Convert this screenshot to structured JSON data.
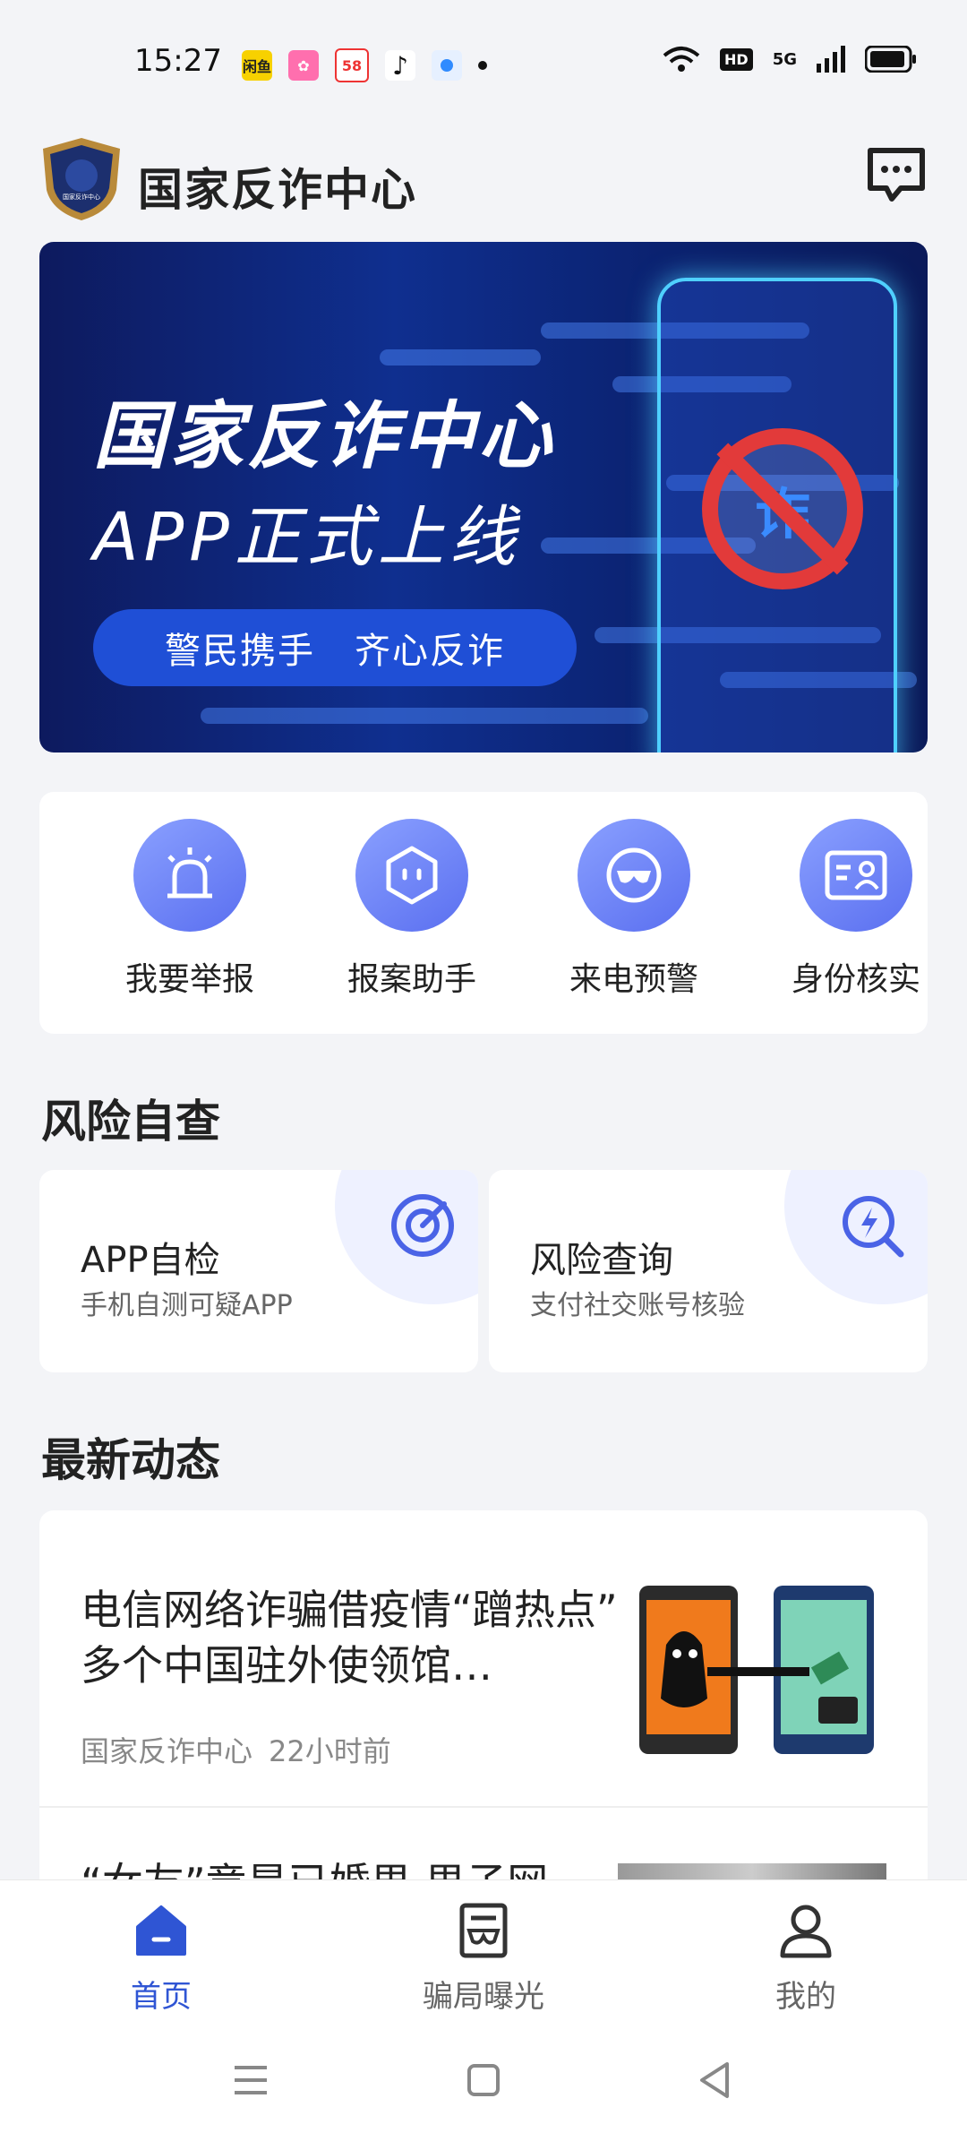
{
  "status_bar": {
    "time": "15:27",
    "notifications": [
      "闲鱼",
      "58",
      "TikTok"
    ],
    "hd_label": "HD",
    "network_label": "5G",
    "colors": {
      "app1": "#f7d100",
      "app2": "#ff6fae",
      "app3": "#e33",
      "app4": "#111",
      "app5": "#2f8bff"
    }
  },
  "header": {
    "title": "国家反诈中心",
    "logo_text": "国家反诈中心"
  },
  "banner": {
    "title": "国家反诈中心",
    "subtitle": "APP正式上线",
    "pill_left": "警民携手",
    "pill_right": "齐心反诈",
    "badge_char": "诈"
  },
  "quick_actions": [
    {
      "label": "我要举报",
      "icon": "alarm-siren-icon"
    },
    {
      "label": "报案助手",
      "icon": "hexagon-robot-icon"
    },
    {
      "label": "来电预警",
      "icon": "mask-icon"
    },
    {
      "label": "身份核实",
      "icon": "id-card-icon"
    }
  ],
  "risk_section": {
    "title": "风险自查",
    "cards": [
      {
        "title": "APP自检",
        "subtitle": "手机自测可疑APP",
        "icon": "target-icon"
      },
      {
        "title": "风险查询",
        "subtitle": "支付社交账号核验",
        "icon": "search-bolt-icon"
      }
    ]
  },
  "news_section": {
    "title": "最新动态",
    "items": [
      {
        "title": "电信网络诈骗借疫情“蹭热点” 多个中国驻外使领馆…",
        "source": "国家反诈中心",
        "time": "22小时前"
      },
      {
        "title": "“女友”竟是已婚男 男子网…"
      }
    ]
  },
  "tabbar": {
    "tabs": [
      {
        "label": "首页",
        "icon": "home-icon",
        "active": true
      },
      {
        "label": "骗局曝光",
        "icon": "document-mask-icon",
        "active": false
      },
      {
        "label": "我的",
        "icon": "person-icon",
        "active": false
      }
    ],
    "active_color": "#2f55d4"
  }
}
